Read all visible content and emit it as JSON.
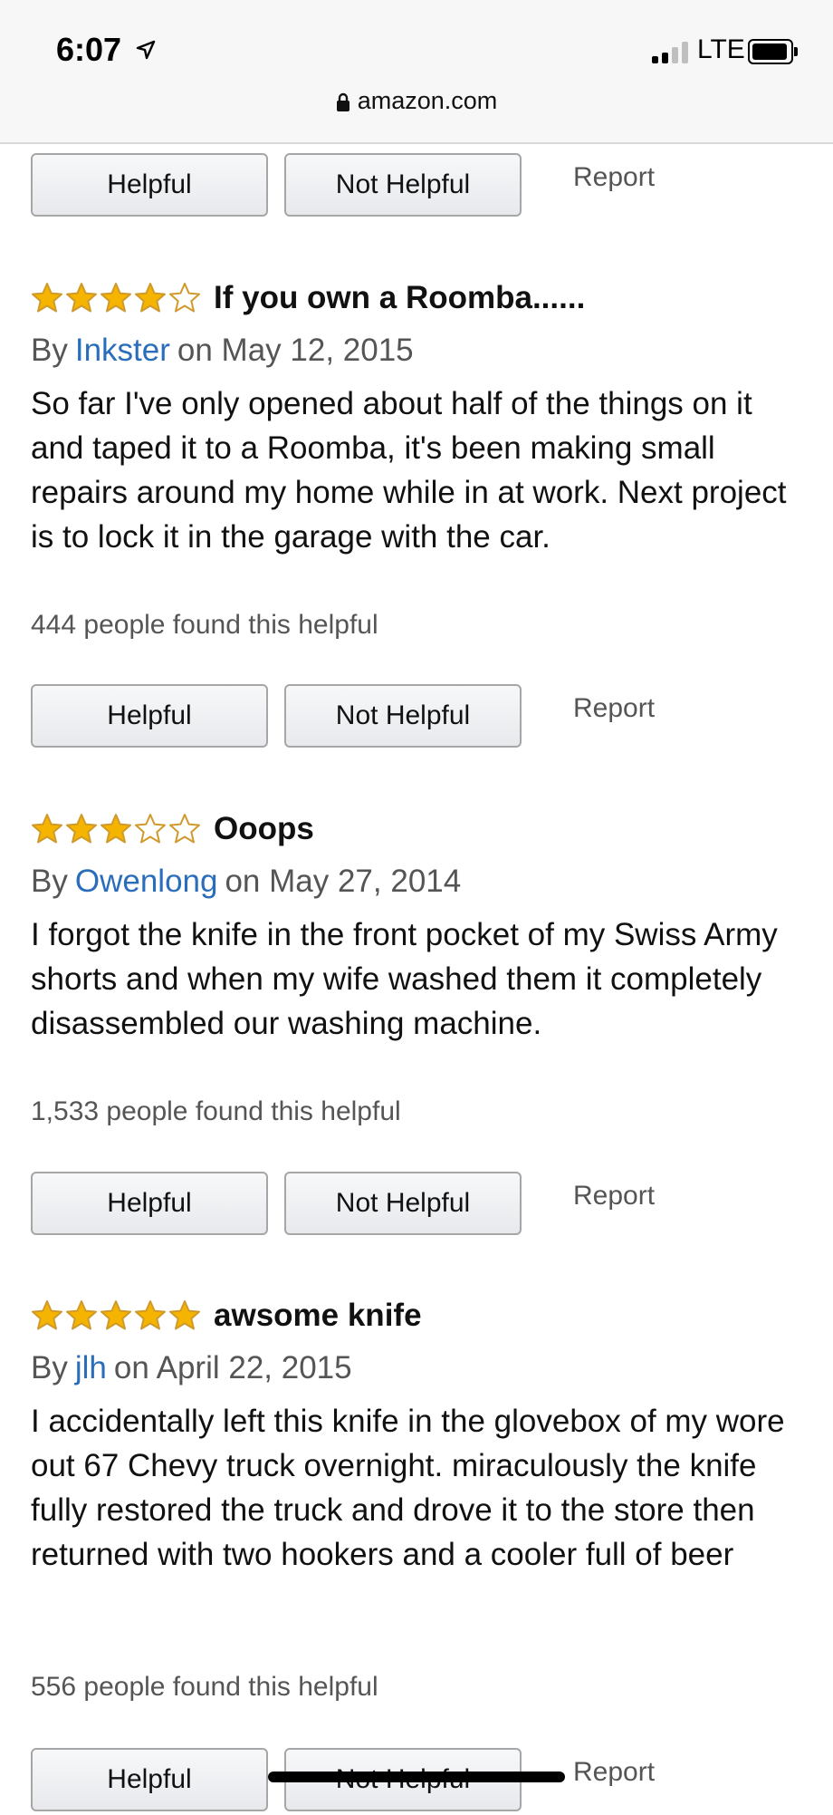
{
  "status": {
    "time": "6:07",
    "network": "LTE",
    "url": "amazon.com"
  },
  "buttons": {
    "helpful": "Helpful",
    "not_helpful": "Not Helpful",
    "report": "Report"
  },
  "reviews": [
    {
      "stars": 4,
      "title": "If you own a Roomba......",
      "by": "By",
      "author": "Inkster",
      "date": "on May 12, 2015",
      "body": "So far I've only opened about half of the things on it and taped it to a Roomba, it's been making small repairs around my home while in at work. Next project is to lock it in the garage with the car.",
      "helpful_text": "444 people found this helpful"
    },
    {
      "stars": 3,
      "title": "Ooops",
      "by": "By",
      "author": "Owenlong",
      "date": "on May 27, 2014",
      "body": "I forgot the knife in the front pocket of my Swiss Army shorts and when my wife washed them it completely disassembled our washing machine.",
      "helpful_text": "1,533 people found this helpful"
    },
    {
      "stars": 5,
      "title": "awsome knife",
      "by": "By",
      "author": "jlh",
      "date": "on April 22, 2015",
      "body": "I accidentally left this knife in the glovebox of my wore out 67 Chevy truck overnight. miraculously the knife fully restored the truck and drove it to the store then returned with two hookers and a cooler full of beer",
      "helpful_text": "556 people found this helpful"
    }
  ],
  "colors": {
    "star_fill": "#f4b400",
    "star_outline": "#d09a2a",
    "link": "#2a6ebb"
  }
}
